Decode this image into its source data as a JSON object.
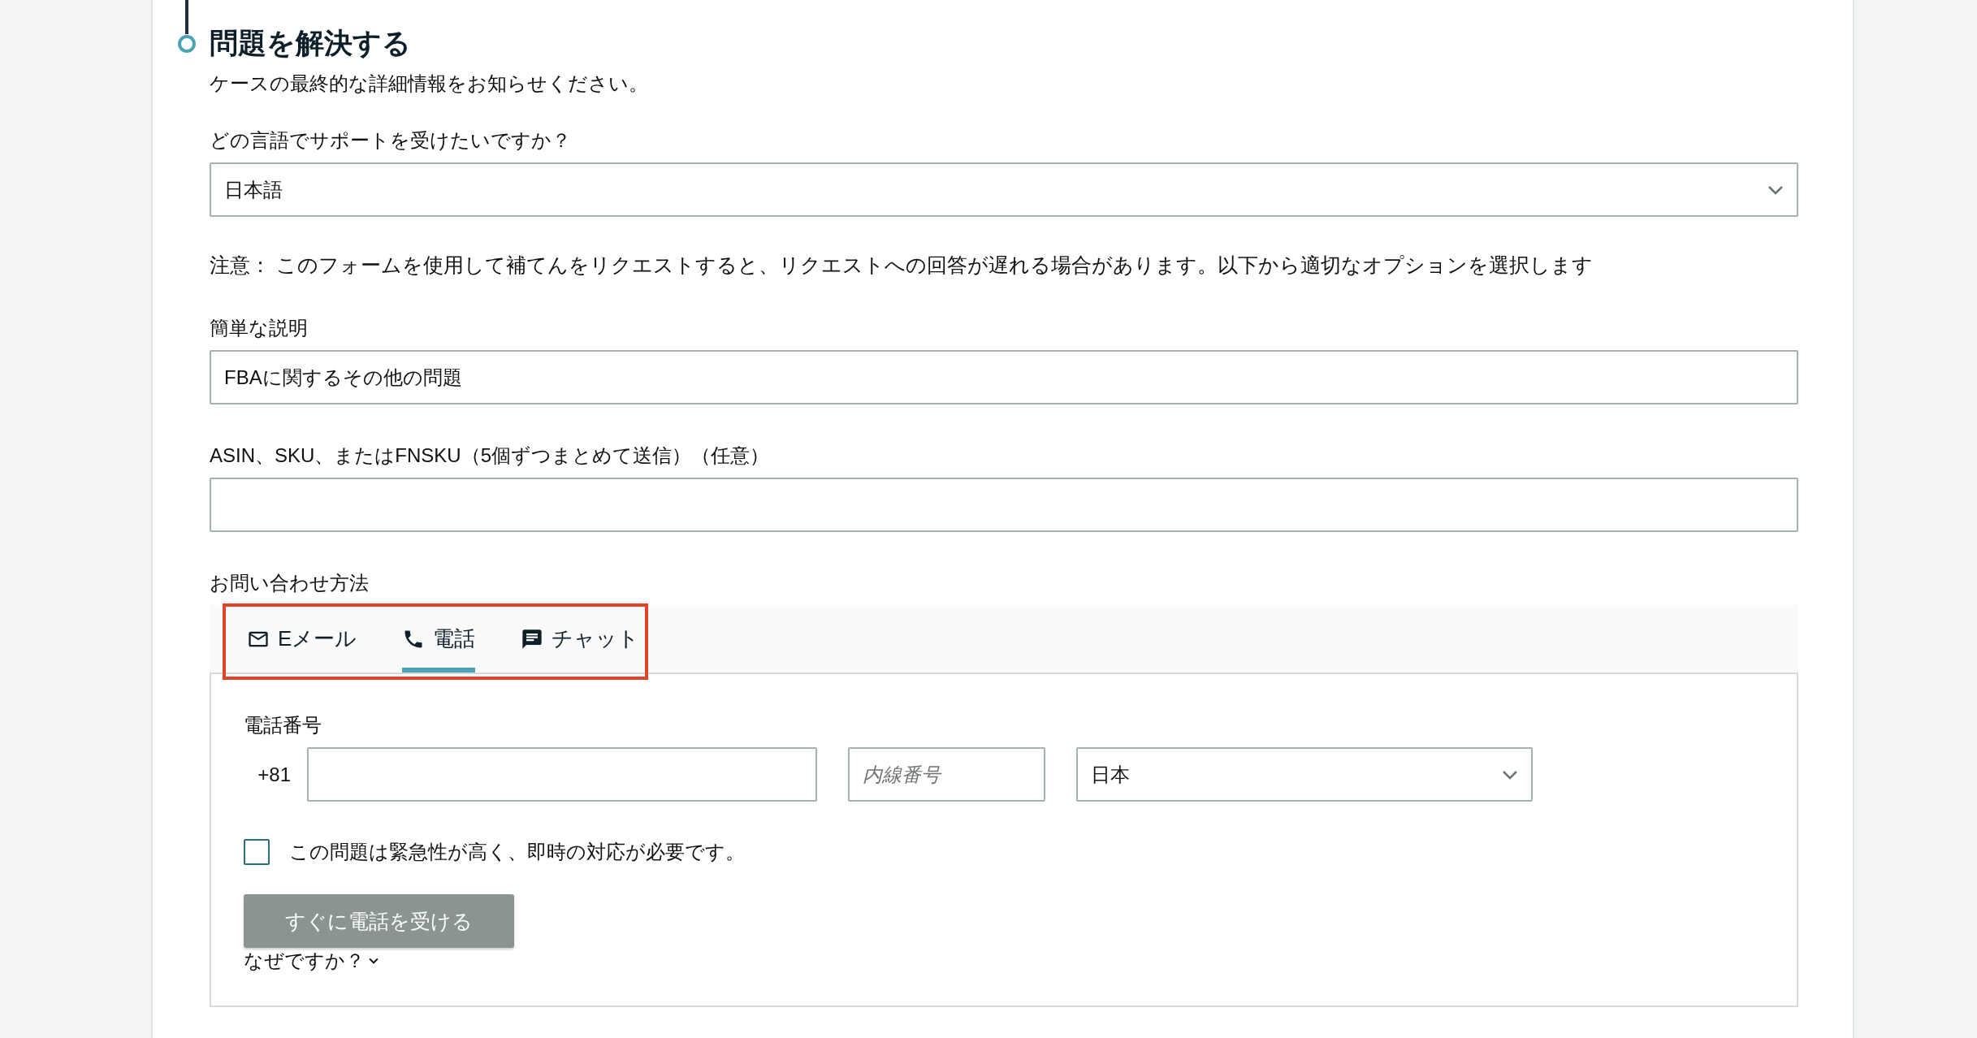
{
  "step": {
    "title": "問題を解決する",
    "subtitle": "ケースの最終的な詳細情報をお知らせください。"
  },
  "language": {
    "label": "どの言語でサポートを受けたいですか？",
    "value": "日本語"
  },
  "notice": "注意： このフォームを使用して補てんをリクエストすると、リクエストへの回答が遅れる場合があります。以下から適切なオプションを選択します",
  "short_description": {
    "label": "簡単な説明",
    "value": "FBAに関するその他の問題"
  },
  "asin": {
    "label": "ASIN、SKU、またはFNSKU（5個ずつまとめて送信）（任意）"
  },
  "contact": {
    "label": "お問い合わせ方法",
    "highlighted": true,
    "tabs": [
      {
        "kind": "email",
        "label": "Eメール",
        "selected": false
      },
      {
        "kind": "phone",
        "label": "電話",
        "selected": true
      },
      {
        "kind": "chat",
        "label": "チャット",
        "selected": false
      }
    ],
    "phone": {
      "label": "電話番号",
      "prefix": "+81",
      "extension_placeholder": "内線番号",
      "country": "日本"
    },
    "urgent": {
      "label": "この問題は緊急性が高く、即時の対応が必要です。",
      "checked": false
    },
    "call_button": {
      "label": "すぐに電話を受ける",
      "disabled": true
    },
    "why_link": "なぜですか？"
  }
}
